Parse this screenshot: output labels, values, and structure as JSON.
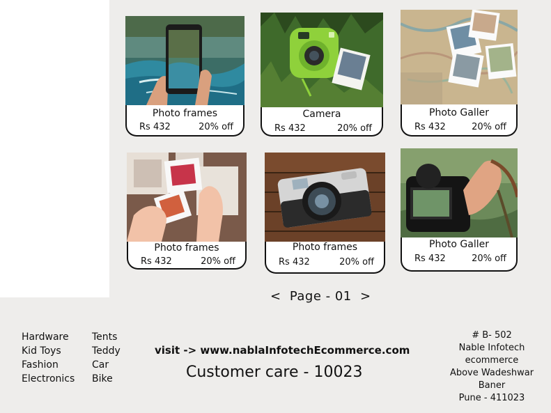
{
  "products": [
    {
      "title": "Photo frames",
      "price": "Rs 432",
      "discount": "20% off",
      "image": "hand-phone-river-photo"
    },
    {
      "title": "Camera",
      "price": "Rs 432",
      "discount": "20% off",
      "image": "green-instant-camera-photo"
    },
    {
      "title": "Photo Galler",
      "price": "Rs 432",
      "discount": "20% off",
      "image": "polaroids-on-map-photo"
    },
    {
      "title": "Photo frames",
      "price": "Rs 432",
      "discount": "20% off",
      "image": "hands-holding-slides-photo"
    },
    {
      "title": "Photo frames",
      "price": "Rs 432",
      "discount": "20% off",
      "image": "retro-camera-on-wood-photo"
    },
    {
      "title": "Photo Galler",
      "price": "Rs 432",
      "discount": "20% off",
      "image": "hand-holding-dslr-photo"
    }
  ],
  "pager": {
    "prev": "<",
    "label": "Page - 01",
    "next": ">"
  },
  "footer": {
    "categories_left": [
      "Hardware",
      "Kid Toys",
      "Fashion",
      "Electronics"
    ],
    "categories_right": [
      "Tents",
      "Teddy",
      "Car",
      "Bike"
    ],
    "visit": "visit -> www.nablaInfotechEcommerce.com",
    "customer_care": "Customer care - 10023",
    "address": [
      "# B- 502",
      "Nable Infotech",
      "ecommerce",
      "Above Wadeshwar",
      "Baner",
      "Pune - 411023"
    ]
  }
}
